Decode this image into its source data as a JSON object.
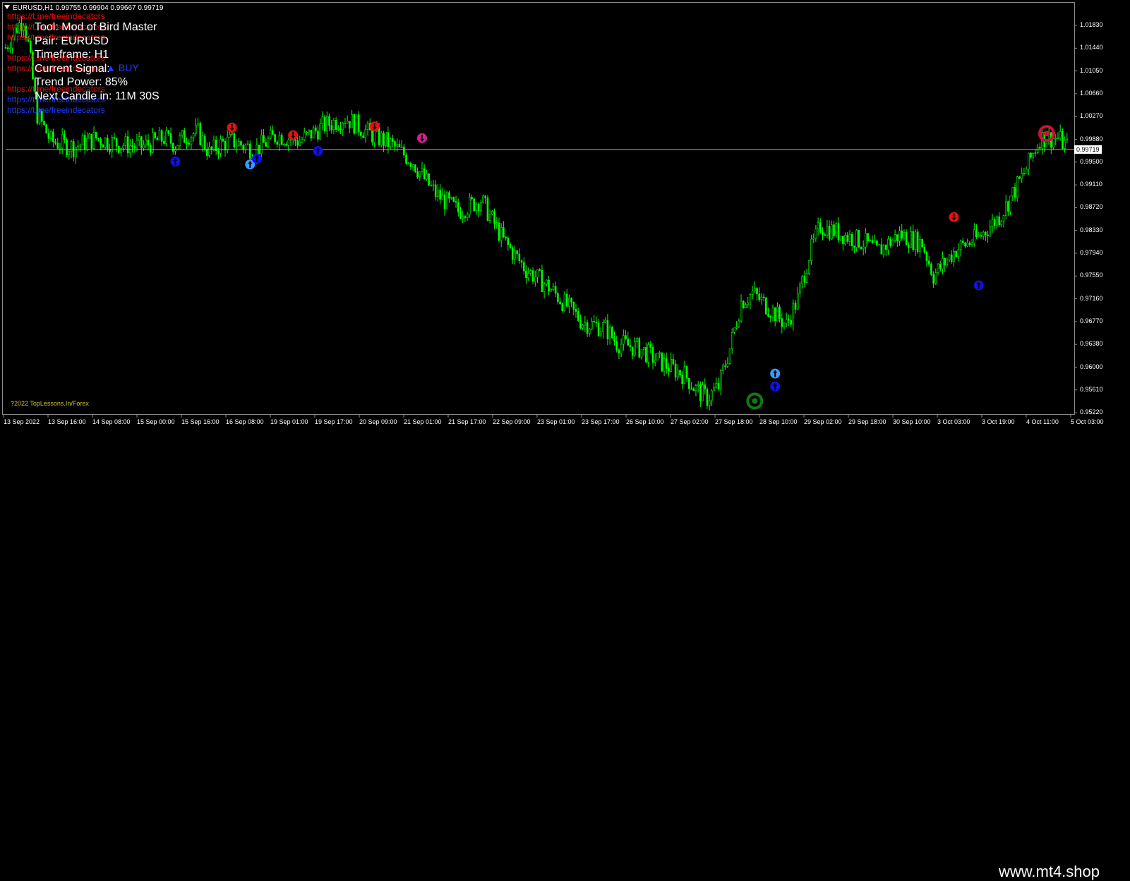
{
  "symbol_header": "EURUSD,H1  0.99755 0.99904 0.99667 0.99719",
  "links": [
    {
      "text": "https://t.me/freeindecators",
      "color": "#e01010",
      "top": 16
    },
    {
      "text": "https://t.me/freeindecators",
      "color": "#e01010",
      "top": 31
    },
    {
      "text": "https://t.me/freeindecators",
      "color": "#e01010",
      "top": 46
    },
    {
      "text": "https://t.me/freeindecators",
      "color": "#e01010",
      "top": 75
    },
    {
      "text": "https://t.me/freeindecators",
      "color": "#e01010",
      "top": 90
    },
    {
      "text": "https://t.me/freeindecators",
      "color": "#e01010",
      "top": 119
    },
    {
      "text": "https://t.me/freeindecators",
      "color": "#1f3cff",
      "top": 134
    },
    {
      "text": "https://t.me/freeindecators",
      "color": "#1f3cff",
      "top": 149
    }
  ],
  "info": {
    "tool": "Tool: Mod of Bird Master",
    "pair": "Pair: EURUSD",
    "timeframe": "Timeframe: H1",
    "current_signal": "Current Signal:",
    "signal_value": "▲ BUY",
    "trend_power": "Trend Power: 85%",
    "next_candle": "Next Candle in: 11M 30S"
  },
  "copyright": "?2022 TopLessons.In/Forex",
  "watermark": "www.mt4.shop",
  "current_price": "0.99719",
  "colors": {
    "candle": "#00ff00",
    "sell_arrow": "#e81010",
    "buy_arrow": "#1010e8",
    "buy_arrow_light": "#3a9bff",
    "strong_sell": "#d02090",
    "circle_sell": "#d0103a",
    "circle_buy": "#107a10",
    "price_line": "#b0b0b0"
  },
  "chart_data": {
    "type": "candlestick",
    "y_ticks": [
      "1.01830",
      "1.01440",
      "1.01050",
      "1.00660",
      "1.00270",
      "0.99880",
      "0.99500",
      "0.99110",
      "0.98720",
      "0.98330",
      "0.97940",
      "0.97550",
      "0.97160",
      "0.96770",
      "0.96380",
      "0.96000",
      "0.95610",
      "0.95220"
    ],
    "x_ticks": [
      "13 Sep 2022",
      "13 Sep 16:00",
      "14 Sep 08:00",
      "15 Sep 00:00",
      "15 Sep 16:00",
      "16 Sep 08:00",
      "19 Sep 01:00",
      "19 Sep 17:00",
      "20 Sep 09:00",
      "21 Sep 01:00",
      "21 Sep 17:00",
      "22 Sep 09:00",
      "23 Sep 01:00",
      "23 Sep 17:00",
      "26 Sep 10:00",
      "27 Sep 02:00",
      "27 Sep 18:00",
      "28 Sep 10:00",
      "29 Sep 02:00",
      "29 Sep 18:00",
      "30 Sep 10:00",
      "3 Oct 03:00",
      "3 Oct 19:00",
      "4 Oct 11:00",
      "5 Oct 03:00"
    ],
    "ylim": [
      0.9522,
      1.0222
    ],
    "xlim": [
      0,
      375
    ],
    "path": [
      [
        0,
        1.0145
      ],
      [
        5,
        1.018
      ],
      [
        8,
        1.0195
      ],
      [
        10,
        1.015
      ],
      [
        14,
        1.003
      ],
      [
        20,
        0.9985
      ],
      [
        30,
        0.9975
      ],
      [
        40,
        0.999
      ],
      [
        50,
        0.998
      ],
      [
        60,
        0.9975
      ],
      [
        70,
        0.999
      ],
      [
        75,
        0.998
      ],
      [
        80,
        0.9995
      ],
      [
        85,
        1.0
      ],
      [
        90,
        0.9965
      ],
      [
        95,
        0.998
      ],
      [
        100,
        0.9985
      ],
      [
        110,
        0.997
      ],
      [
        120,
        0.9995
      ],
      [
        130,
        0.9985
      ],
      [
        140,
        1.001
      ],
      [
        150,
        1.0025
      ],
      [
        160,
        1.0
      ],
      [
        170,
        0.998
      ],
      [
        175,
        0.9965
      ],
      [
        180,
        0.995
      ],
      [
        185,
        0.992
      ],
      [
        190,
        0.9895
      ],
      [
        200,
        0.9865
      ],
      [
        210,
        0.9885
      ],
      [
        215,
        0.985
      ],
      [
        220,
        0.9815
      ],
      [
        225,
        0.979
      ],
      [
        230,
        0.9765
      ],
      [
        240,
        0.9735
      ],
      [
        250,
        0.9695
      ],
      [
        255,
        0.9675
      ],
      [
        265,
        0.9665
      ],
      [
        270,
        0.964
      ],
      [
        280,
        0.963
      ],
      [
        290,
        0.9605
      ],
      [
        300,
        0.9585
      ],
      [
        305,
        0.956
      ],
      [
        310,
        0.9545
      ],
      [
        315,
        0.9565
      ],
      [
        320,
        0.963
      ],
      [
        325,
        0.971
      ],
      [
        330,
        0.9725
      ],
      [
        340,
        0.969
      ],
      [
        345,
        0.967
      ],
      [
        350,
        0.9715
      ],
      [
        355,
        0.979
      ],
      [
        360,
        0.984
      ],
      [
        370,
        0.9825
      ],
      [
        380,
        0.981
      ],
      [
        385,
        0.9795
      ],
      [
        390,
        0.981
      ],
      [
        395,
        0.9825
      ],
      [
        405,
        0.981
      ],
      [
        410,
        0.9755
      ],
      [
        420,
        0.98
      ],
      [
        430,
        0.982
      ],
      [
        440,
        0.986
      ],
      [
        450,
        0.993
      ],
      [
        457,
        0.999
      ],
      [
        465,
        0.999
      ],
      [
        470,
        0.9972
      ]
    ],
    "signals": [
      {
        "type": "sell",
        "x": 100,
        "y": 1.0008,
        "c": "sell_arrow"
      },
      {
        "type": "buy",
        "x": 75,
        "y": 0.995,
        "c": "buy_arrow"
      },
      {
        "type": "buy",
        "x": 108,
        "y": 0.9945,
        "c": "buy_arrow_light"
      },
      {
        "type": "buy",
        "x": 111,
        "y": 0.9955,
        "c": "buy_arrow"
      },
      {
        "type": "sell",
        "x": 127,
        "y": 0.9995,
        "c": "sell_arrow"
      },
      {
        "type": "buy",
        "x": 138,
        "y": 0.9968,
        "c": "buy_arrow"
      },
      {
        "type": "sell",
        "x": 163,
        "y": 1.001,
        "c": "sell_arrow"
      },
      {
        "type": "sell",
        "x": 184,
        "y": 0.999,
        "c": "strong_sell"
      },
      {
        "type": "buy",
        "x": 340,
        "y": 0.9587,
        "c": "buy_arrow_light"
      },
      {
        "type": "buy",
        "x": 340,
        "y": 0.9565,
        "c": "buy_arrow"
      },
      {
        "type": "sell",
        "x": 419,
        "y": 0.9855,
        "c": "sell_arrow"
      },
      {
        "type": "buy",
        "x": 430,
        "y": 0.9738,
        "c": "buy_arrow"
      },
      {
        "type": "circle",
        "x": 331,
        "y": 0.954,
        "c": "circle_buy"
      },
      {
        "type": "circle",
        "x": 460,
        "y": 0.9998,
        "c": "circle_sell"
      }
    ]
  }
}
